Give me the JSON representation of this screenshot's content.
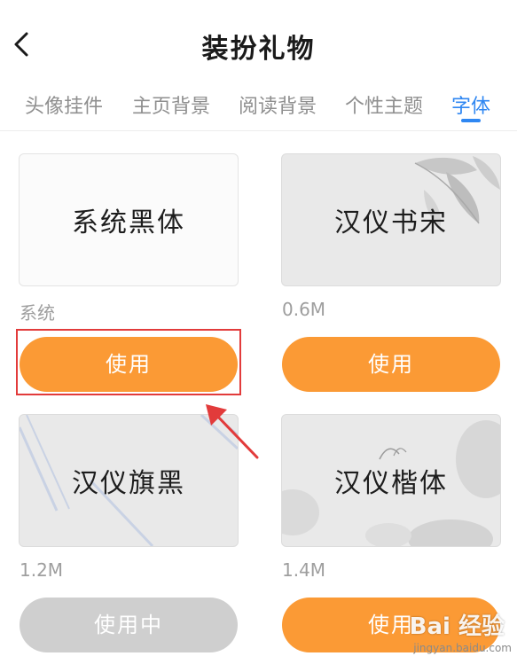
{
  "header": {
    "title": "装扮礼物"
  },
  "tabs": [
    {
      "label": "头像挂件"
    },
    {
      "label": "主页背景"
    },
    {
      "label": "阅读背景"
    },
    {
      "label": "个性主题"
    },
    {
      "label": "字体",
      "active": true
    }
  ],
  "fonts": [
    {
      "preview": "系统黑体",
      "size": "系统",
      "button": "使用"
    },
    {
      "preview": "汉仪书宋",
      "size": "0.6M",
      "button": "使用"
    },
    {
      "preview": "汉仪旗黑",
      "size": "1.2M",
      "button": "使用中"
    },
    {
      "preview": "汉仪楷体",
      "size": "1.4M",
      "button": "使用"
    }
  ],
  "watermark": {
    "main": "Bai 经验",
    "sub": "jingyan.baidu.com"
  },
  "colors": {
    "accent": "#fb9a35",
    "tab_active": "#2f87f2",
    "in_use": "#cfcfcf",
    "annotation": "#e23b3b"
  }
}
